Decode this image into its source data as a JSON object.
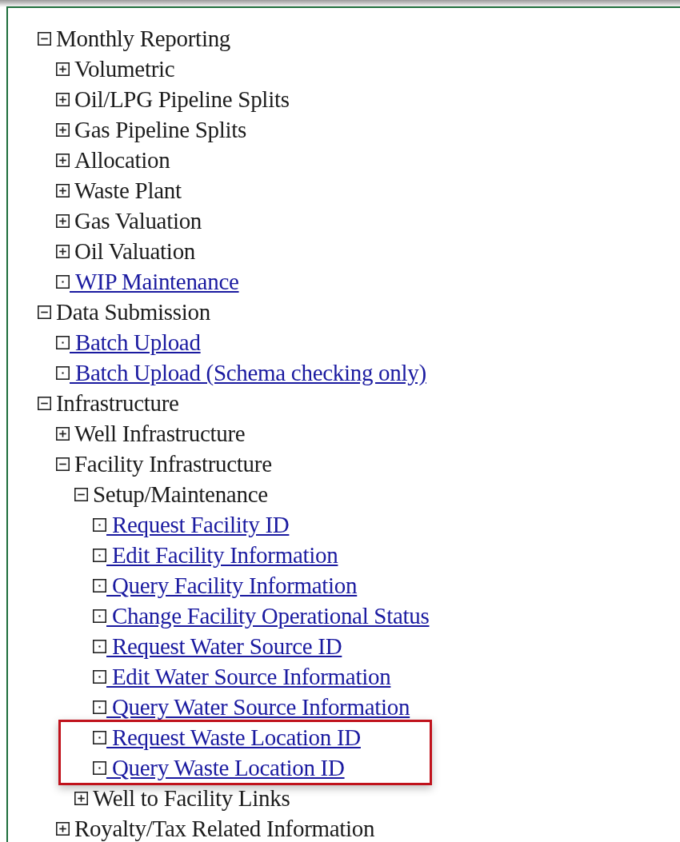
{
  "tree": [
    {
      "label": "Monthly Reporting",
      "kind": "folder",
      "expanded": true,
      "children": [
        {
          "label": "Volumetric",
          "kind": "folder",
          "expanded": false
        },
        {
          "label": "Oil/LPG Pipeline Splits",
          "kind": "folder",
          "expanded": false
        },
        {
          "label": "Gas Pipeline Splits",
          "kind": "folder",
          "expanded": false
        },
        {
          "label": "Allocation",
          "kind": "folder",
          "expanded": false
        },
        {
          "label": "Waste Plant",
          "kind": "folder",
          "expanded": false
        },
        {
          "label": "Gas Valuation",
          "kind": "folder",
          "expanded": false
        },
        {
          "label": "Oil Valuation",
          "kind": "folder",
          "expanded": false
        },
        {
          "label": "WIP Maintenance",
          "kind": "link",
          "highlighted": false
        }
      ]
    },
    {
      "label": "Data Submission",
      "kind": "folder",
      "expanded": true,
      "children": [
        {
          "label": "Batch Upload",
          "kind": "link",
          "highlighted": false
        },
        {
          "label": "Batch Upload (Schema checking only)",
          "kind": "link",
          "highlighted": false
        }
      ]
    },
    {
      "label": "Infrastructure",
      "kind": "folder",
      "expanded": true,
      "children": [
        {
          "label": "Well Infrastructure",
          "kind": "folder",
          "expanded": false
        },
        {
          "label": "Facility Infrastructure",
          "kind": "folder",
          "expanded": true,
          "children": [
            {
              "label": "Setup/Maintenance",
              "kind": "folder",
              "expanded": true,
              "children": [
                {
                  "label": "Request Facility ID",
                  "kind": "link",
                  "highlighted": false
                },
                {
                  "label": "Edit Facility Information",
                  "kind": "link",
                  "highlighted": false
                },
                {
                  "label": "Query Facility Information",
                  "kind": "link",
                  "highlighted": false
                },
                {
                  "label": "Change Facility Operational Status",
                  "kind": "link",
                  "highlighted": false
                },
                {
                  "label": "Request Water Source ID",
                  "kind": "link",
                  "highlighted": false
                },
                {
                  "label": "Edit Water Source Information",
                  "kind": "link",
                  "highlighted": false
                },
                {
                  "label": "Query Water Source Information",
                  "kind": "link",
                  "highlighted": false
                },
                {
                  "label": "Request Waste Location ID",
                  "kind": "link",
                  "highlighted": true
                },
                {
                  "label": "Query Waste Location ID",
                  "kind": "link",
                  "highlighted": true
                }
              ]
            },
            {
              "label": "Well to Facility Links",
              "kind": "folder",
              "expanded": false
            }
          ]
        },
        {
          "label": "Royalty/Tax Related Information",
          "kind": "folder",
          "expanded": false
        }
      ]
    }
  ]
}
